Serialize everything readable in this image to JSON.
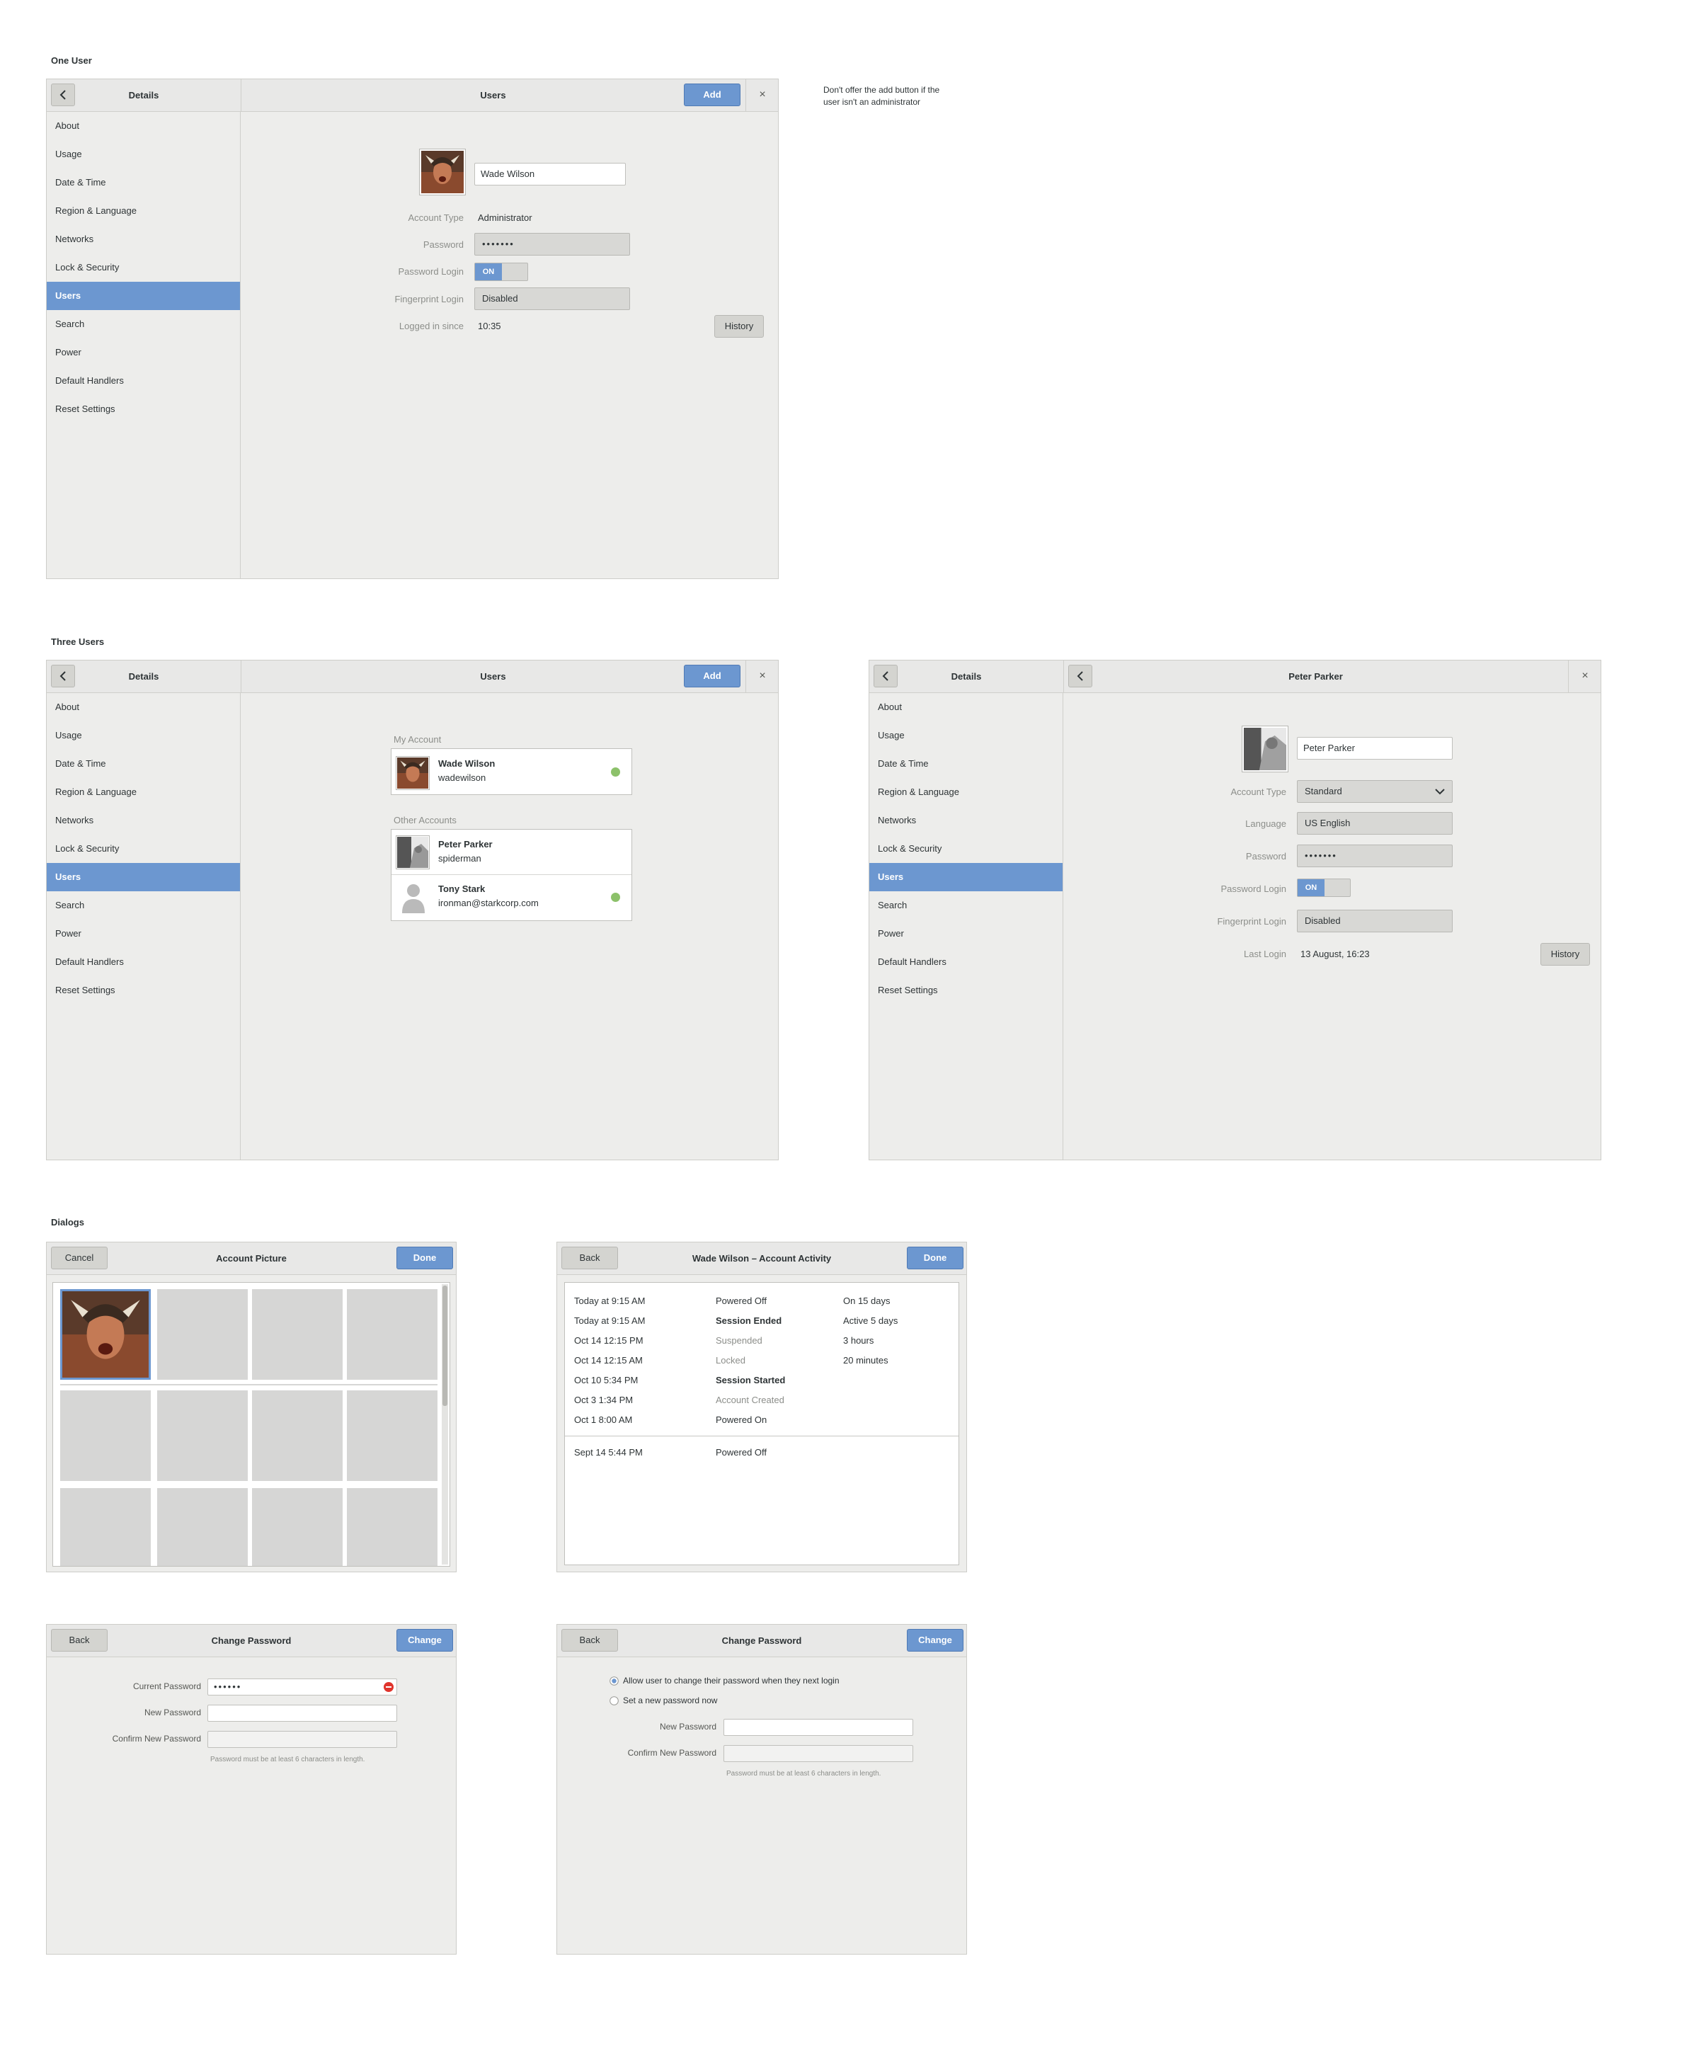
{
  "sections": {
    "one_user": "One User",
    "three_users": "Three Users",
    "dialogs": "Dialogs"
  },
  "note": "Don't offer the add button if the\nuser isn't an administrator",
  "sidebar_items": [
    "About",
    "Usage",
    "Date & Time",
    "Region & Language",
    "Networks",
    "Lock & Security",
    "Users",
    "Search",
    "Power",
    "Default Handlers",
    "Reset Settings"
  ],
  "common": {
    "details_title": "Details",
    "users_title": "Users",
    "add_label": "Add",
    "close_glyph": "×",
    "history_label": "History"
  },
  "one_user": {
    "name_value": "Wade Wilson",
    "account_type_label": "Account Type",
    "account_type_value": "Administrator",
    "password_label": "Password",
    "password_value": "•••••••",
    "password_login_label": "Password Login",
    "toggle_on": "ON",
    "fingerprint_label": "Fingerprint Login",
    "fingerprint_value": "Disabled",
    "logged_in_label": "Logged in since",
    "logged_in_value": "10:35"
  },
  "three_users": {
    "my_account_label": "My Account",
    "other_accounts_label": "Other Accounts",
    "my_account": {
      "name": "Wade Wilson",
      "username": "wadewilson"
    },
    "others": [
      {
        "name": "Peter Parker",
        "username": "spiderman"
      },
      {
        "name": "Tony Stark",
        "username": "ironman@starkcorp.com"
      }
    ]
  },
  "peter": {
    "title": "Peter Parker",
    "name_value": "Peter Parker",
    "account_type_label": "Account Type",
    "account_type_value": "Standard",
    "language_label": "Language",
    "language_value": "US English",
    "password_label": "Password",
    "password_value": "•••••••",
    "password_login_label": "Password Login",
    "toggle_on": "ON",
    "fingerprint_label": "Fingerprint Login",
    "fingerprint_value": "Disabled",
    "last_login_label": "Last Login",
    "last_login_value": "13 August, 16:23"
  },
  "account_picture": {
    "cancel_label": "Cancel",
    "title": "Account Picture",
    "done_label": "Done"
  },
  "activity": {
    "back_label": "Back",
    "title": "Wade Wilson – Account Activity",
    "done_label": "Done",
    "rows": [
      {
        "time": "Today at 9:15 AM",
        "event": "Powered Off",
        "style": "normal",
        "dur": "On 15 days"
      },
      {
        "time": "Today at 9:15 AM",
        "event": "Session Ended",
        "style": "bold",
        "dur": "Active 5 days"
      },
      {
        "time": "Oct 14 12:15 PM",
        "event": "Suspended",
        "style": "dim",
        "dur": "3 hours"
      },
      {
        "time": "Oct 14 12:15 AM",
        "event": "Locked",
        "style": "dim",
        "dur": "20 minutes"
      },
      {
        "time": "Oct 10 5:34 PM",
        "event": "Session Started",
        "style": "bold",
        "dur": ""
      },
      {
        "time": "Oct 3 1:34 PM",
        "event": "Account Created",
        "style": "dim",
        "dur": ""
      },
      {
        "time": "Oct 1 8:00 AM",
        "event": "Powered On",
        "style": "normal",
        "dur": ""
      }
    ],
    "extra_row": {
      "time": "Sept 14 5:44 PM",
      "event": "Powered Off"
    }
  },
  "change_password_1": {
    "back_label": "Back",
    "title": "Change Password",
    "change_label": "Change",
    "current_label": "Current Password",
    "current_value": "••••••",
    "new_label": "New Password",
    "confirm_label": "Confirm New Password",
    "hint": "Password must be at least 6 characters in length."
  },
  "change_password_2": {
    "back_label": "Back",
    "title": "Change Password",
    "change_label": "Change",
    "radio_1": "Allow user to change their password when they next login",
    "radio_2": "Set a new password now",
    "new_label": "New Password",
    "confirm_label": "Confirm New Password",
    "hint": "Password must be at least 6 characters in length."
  },
  "colors": {
    "accent": "#6c97d0",
    "online": "#8cc16a",
    "background": "#ededeb"
  },
  "icons": [
    "back-arrow-icon",
    "close-icon",
    "chevron-down-icon",
    "user-placeholder-icon",
    "error-icon",
    "radio-icon"
  ]
}
